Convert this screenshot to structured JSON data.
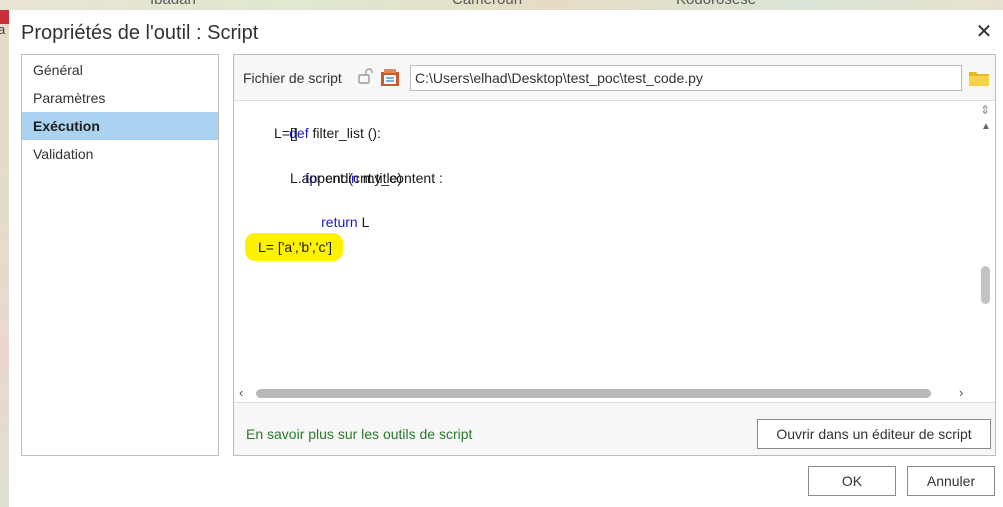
{
  "background_map": {
    "labels": [
      "Ibadan",
      "Cameroun",
      "Kodorosese"
    ],
    "left_fragment": "a"
  },
  "dialog": {
    "title": "Propriétés de l'outil : Script",
    "close_glyph": "✕"
  },
  "nav": {
    "items": [
      {
        "label": "Général",
        "active": false
      },
      {
        "label": "Paramètres",
        "active": false
      },
      {
        "label": "Exécution",
        "active": true
      },
      {
        "label": "Validation",
        "active": false
      }
    ]
  },
  "script_file": {
    "label": "Fichier de script",
    "path": "C:\\Users\\elhad\\Desktop\\test_poc\\test_code.py"
  },
  "code": {
    "line1_kw": "def",
    "line1_rest": " filter_list ():",
    "line2": "L=[]",
    "line3_kw1": "for",
    "line3_mid": " cnt ",
    "line3_kw2": "in",
    "line3_rest": " my_content :",
    "line4": "L.append(cnt.title)",
    "line5_kw": "return",
    "line5_rest": " L",
    "highlight_line": "L= ['a','b','c']"
  },
  "footer": {
    "learn_link": "En savoir plus sur les outils de script",
    "open_editor_label": "Ouvrir dans un éditeur de script"
  },
  "buttons": {
    "ok_label": "OK",
    "cancel_label": "Annuler"
  },
  "colors": {
    "nav_active": "#a9d3f0",
    "keyword": "#1c1ccc",
    "highlight": "#fff200",
    "link": "#2a7a2a"
  }
}
